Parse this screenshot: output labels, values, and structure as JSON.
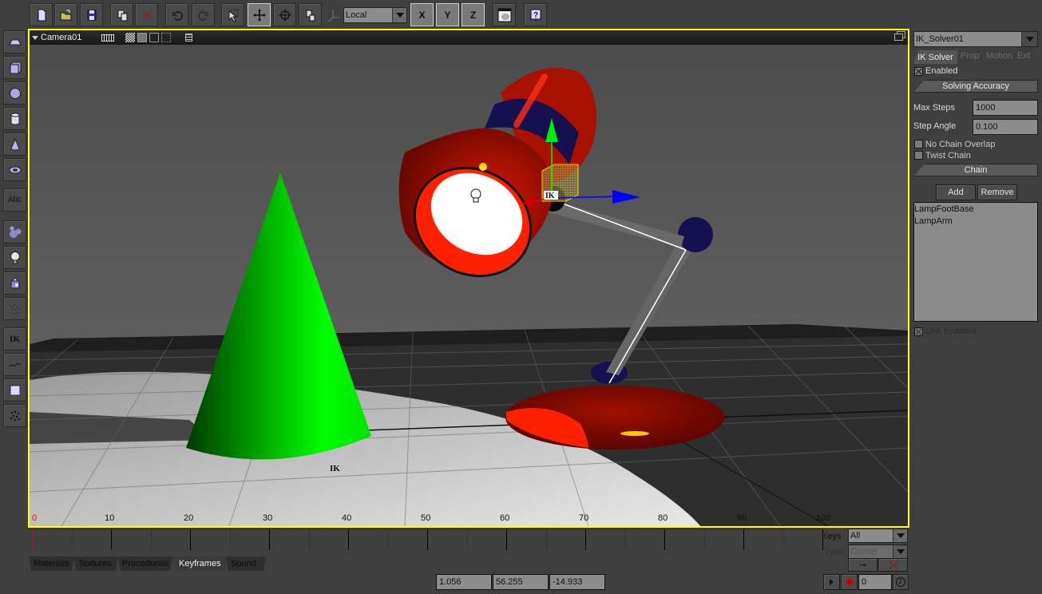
{
  "toolbar": {
    "buttons": [
      {
        "id": "new",
        "icon": "new-file-icon"
      },
      {
        "id": "open",
        "icon": "open-folder-icon"
      },
      {
        "id": "save",
        "icon": "save-disk-icon"
      },
      {
        "id": "copy",
        "icon": "copy-icon"
      },
      {
        "id": "delete",
        "icon": "delete-x-icon"
      },
      {
        "id": "undo",
        "icon": "undo-icon"
      },
      {
        "id": "redo",
        "icon": "redo-icon"
      },
      {
        "id": "select",
        "icon": "select-arrow-icon"
      },
      {
        "id": "move",
        "icon": "move-icon"
      },
      {
        "id": "rotate",
        "icon": "rotate-icon"
      },
      {
        "id": "scale",
        "icon": "scale-icon"
      }
    ],
    "coord_space": "Local",
    "axes": [
      "X",
      "Y",
      "Z"
    ],
    "render_icon": "render-preview-icon",
    "help_icon": "help-icon"
  },
  "left_tools": [
    {
      "name": "plane",
      "icon": "plane-icon"
    },
    {
      "name": "cube",
      "icon": "cube-icon"
    },
    {
      "name": "sphere",
      "icon": "sphere-icon"
    },
    {
      "name": "cylinder",
      "icon": "cylinder-icon"
    },
    {
      "name": "cone",
      "icon": "cone-icon"
    },
    {
      "name": "torus",
      "icon": "torus-icon"
    },
    {
      "name": "text",
      "label": "Abc",
      "icon": "text-icon"
    },
    {
      "name": "metaballs",
      "icon": "metaballs-icon"
    },
    {
      "name": "light",
      "icon": "light-bulb-icon"
    },
    {
      "name": "camera",
      "icon": "camera-icon"
    },
    {
      "name": "particles",
      "icon": "particles-icon"
    },
    {
      "name": "ik",
      "label": "IK",
      "icon": "ik-icon"
    },
    {
      "name": "curve",
      "icon": "curve-icon"
    },
    {
      "name": "lattice",
      "icon": "lattice-icon"
    },
    {
      "name": "particle-system",
      "icon": "particle-system-icon"
    }
  ],
  "viewport": {
    "camera_name": "Camera01",
    "header_icons": [
      "grid-icon",
      "checker-shading-icon",
      "solid-box-icon",
      "wire-box-icon",
      "bounding-box-icon",
      "list-icon"
    ],
    "maximize_icon": "maximize-icon",
    "scene_labels": {
      "ik_handle": "IK",
      "ik_target": "IK"
    },
    "colors": {
      "border": "#ffff00",
      "lamp": "#cc1100",
      "cone": "#00ee00",
      "joint": "#151050"
    }
  },
  "timeline": {
    "ticks": [
      "0",
      "10",
      "20",
      "30",
      "40",
      "50",
      "60",
      "70",
      "80",
      "90",
      "100"
    ],
    "current_frame": "0",
    "keys_label": "Keys",
    "keys_value": "All",
    "type_label": "Type",
    "type_value": "Corner"
  },
  "bottom_tabs": [
    {
      "label": "Materials",
      "active": false
    },
    {
      "label": "Textures",
      "active": false
    },
    {
      "label": "Procedurals",
      "active": false
    },
    {
      "label": "Keyframes",
      "active": true
    },
    {
      "label": "Sound",
      "active": false
    }
  ],
  "coords": {
    "x": "1.056",
    "y": "56.255",
    "z": "-14.933"
  },
  "playback": {
    "play_icon": "play-icon",
    "record_icon": "record-icon",
    "frame": "0",
    "clock_icon": "clock-icon"
  },
  "right_panel": {
    "object_name": "IK_Solver01",
    "tabs": [
      {
        "label": "IK Solver",
        "active": true
      },
      {
        "label": "Prop",
        "active": false
      },
      {
        "label": "Motion",
        "active": false
      },
      {
        "label": "Ext",
        "active": false
      }
    ],
    "enabled_label": "Enabled",
    "enabled": true,
    "solving_accuracy_label": "Solving Accuracy",
    "max_steps_label": "Max Steps",
    "max_steps": "1000",
    "step_angle_label": "Step Angle",
    "step_angle": "0.100",
    "no_chain_overlap_label": "No Chain Overlap",
    "no_chain_overlap": false,
    "twist_chain_label": "Twist Chain",
    "twist_chain": false,
    "chain_label": "Chain",
    "add_label": "Add",
    "remove_label": "Remove",
    "chain_items": [
      "LampFootBase",
      "LampArm"
    ],
    "link_enabled_label": "Link Enabled",
    "link_enabled": true
  }
}
